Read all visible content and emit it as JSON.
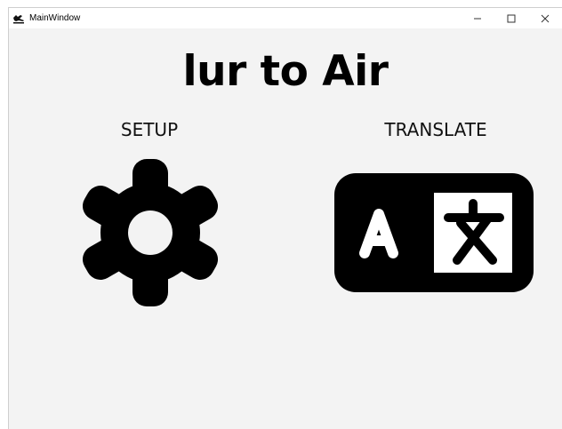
{
  "window": {
    "title": "MainWindow",
    "controls": {
      "minimize_icon": "minimize-icon",
      "maximize_icon": "maximize-icon",
      "close_icon": "close-icon"
    }
  },
  "main": {
    "app_title": "lur to Air",
    "setup": {
      "label": "SETUP",
      "icon": "gear-icon"
    },
    "translate": {
      "label": "TRANSLATE",
      "icon": "translate-icon"
    }
  },
  "colors": {
    "background": "#f3f3f3",
    "icon": "#000000",
    "titlebar": "#ffffff"
  }
}
